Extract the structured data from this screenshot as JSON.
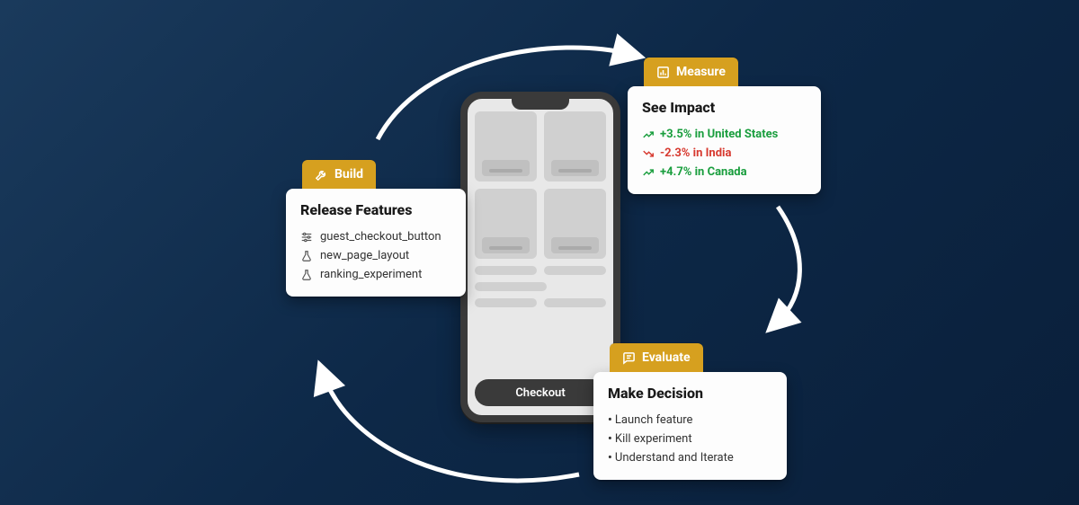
{
  "phone": {
    "checkout_label": "Checkout"
  },
  "build": {
    "tab_label": "Build",
    "title": "Release Features",
    "items": [
      {
        "label": "guest_checkout_button"
      },
      {
        "label": "new_page_layout"
      },
      {
        "label": "ranking_experiment"
      }
    ]
  },
  "measure": {
    "tab_label": "Measure",
    "title": "See Impact",
    "impacts": [
      {
        "direction": "up",
        "text": "+3.5% in United States"
      },
      {
        "direction": "down",
        "text": "-2.3% in India"
      },
      {
        "direction": "up",
        "text": "+4.7% in Canada"
      }
    ]
  },
  "evaluate": {
    "tab_label": "Evaluate",
    "title": "Make Decision",
    "options": [
      {
        "label": "Launch feature"
      },
      {
        "label": "Kill experiment"
      },
      {
        "label": "Understand and Iterate"
      }
    ]
  }
}
